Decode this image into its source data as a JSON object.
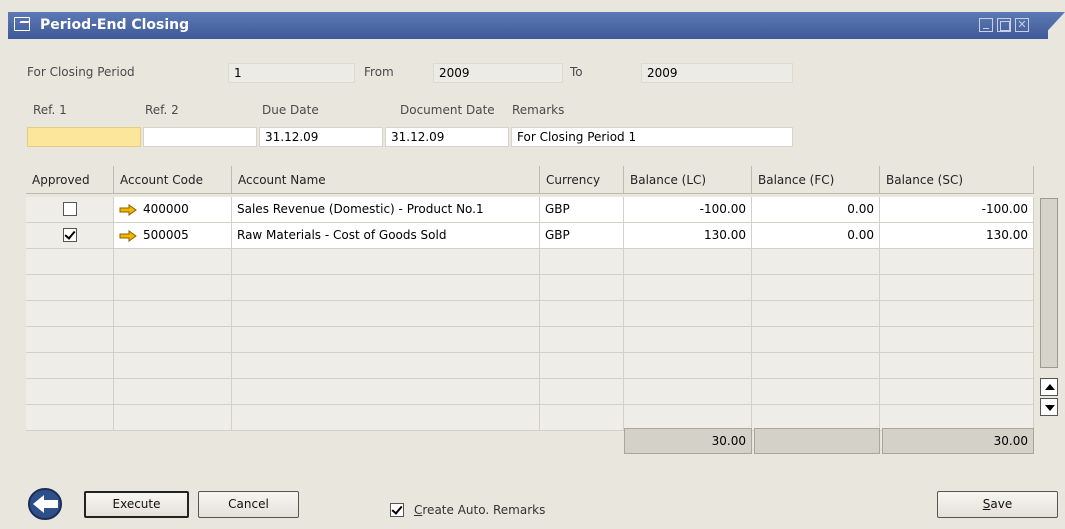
{
  "window": {
    "title": "Period-End Closing",
    "icons": [
      "form-icon",
      "minimize-icon",
      "maximize-icon",
      "close-icon"
    ],
    "accent_color": "#4a66a3"
  },
  "header": {
    "closing_period_label": "For Closing Period",
    "closing_period_value": "1",
    "from_label": "From",
    "from_value": "2009",
    "to_label": "To",
    "to_value": "2009",
    "ref1_label": "Ref. 1",
    "ref1_value": "",
    "ref2_label": "Ref. 2",
    "ref2_value": "",
    "due_date_label": "Due Date",
    "due_date_value": "31.12.09",
    "document_date_label": "Document Date",
    "document_date_value": "31.12.09",
    "remarks_label": "Remarks",
    "remarks_value": "For Closing Period 1"
  },
  "table": {
    "columns": [
      "Approved",
      "Account Code",
      "Account Name",
      "Currency",
      "Balance (LC)",
      "Balance (FC)",
      "Balance (SC)"
    ],
    "rows": [
      {
        "approved": false,
        "account_code": "400000",
        "account_name": "Sales Revenue (Domestic) - Product No.1",
        "currency": "GBP",
        "balance_lc": "-100.00",
        "balance_fc": "0.00",
        "balance_sc": "-100.00"
      },
      {
        "approved": true,
        "account_code": "500005",
        "account_name": "Raw Materials - Cost of Goods Sold",
        "currency": "GBP",
        "balance_lc": "130.00",
        "balance_fc": "0.00",
        "balance_sc": "130.00"
      }
    ],
    "empty_rows": 7,
    "totals": {
      "balance_lc": "30.00",
      "balance_fc": "",
      "balance_sc": "30.00"
    }
  },
  "footer": {
    "execute_label": "Execute",
    "cancel_label": "Cancel",
    "auto_remarks_prefix": "C",
    "auto_remarks_rest": "reate Auto. Remarks",
    "auto_remarks_checked": true,
    "save_prefix": "S",
    "save_rest": "ave"
  }
}
